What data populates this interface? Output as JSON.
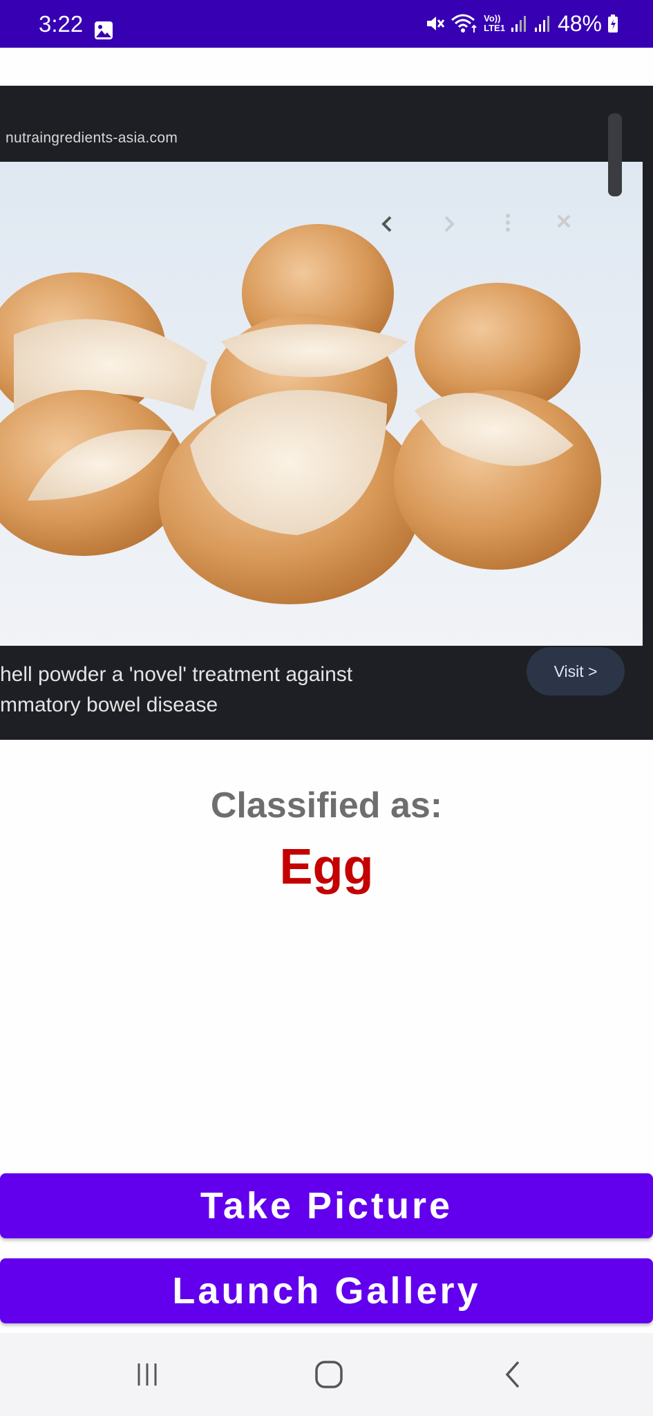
{
  "status_bar": {
    "time": "3:22",
    "battery": "48%",
    "icons": [
      "image-icon",
      "mute-icon",
      "wifi-icon",
      "volte-icon",
      "signal-icon",
      "signal-icon",
      "battery-icon"
    ],
    "volte_line1": "Vo))",
    "volte_line2": "LTE1"
  },
  "photo": {
    "url_text": "nutraingredients-asia.com",
    "caption_line1": "hell powder a 'novel' treatment against",
    "caption_line2": "mmatory bowel disease",
    "visit_label": "Visit >"
  },
  "result": {
    "label": "Classified as:",
    "value": "Egg"
  },
  "buttons": {
    "take_picture": "Take Picture",
    "launch_gallery": "Launch Gallery"
  },
  "colors": {
    "status_bar": "#3700b3",
    "button": "#6200ee",
    "result_value": "#c40000",
    "result_label": "#6e6e6e"
  },
  "nav_icons": [
    "recents-icon",
    "home-icon",
    "back-icon"
  ]
}
